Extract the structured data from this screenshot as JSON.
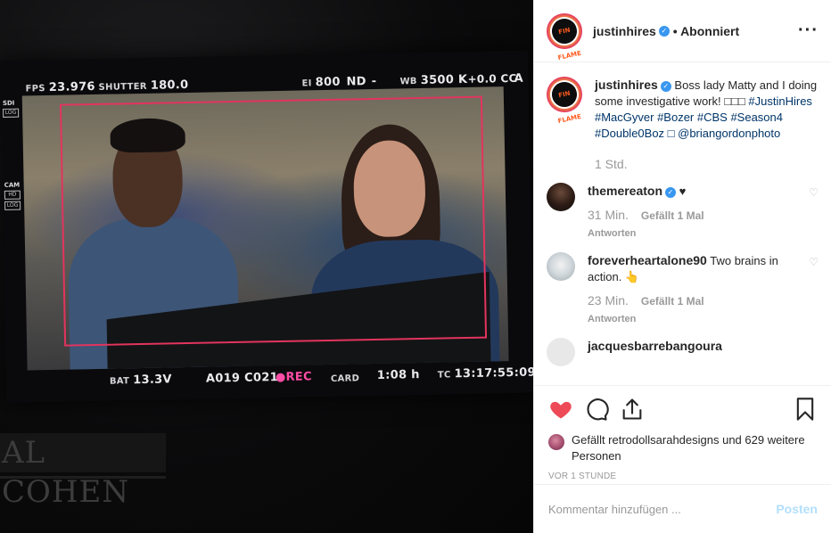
{
  "photo": {
    "hud_top": {
      "fps_label": "FPS",
      "fps_value": "23.976",
      "shutter_label": "SHUTTER",
      "shutter_value": "180.0",
      "ei_label": "EI",
      "ei_value": "800",
      "nd_label": "ND",
      "nd_value": "-",
      "wb_label": "WB",
      "wb_value": "3500 K",
      "cc_value": "+0.0 CC",
      "channel": "A"
    },
    "hud_bottom": {
      "bat_label": "BAT",
      "bat_value": "13.3V",
      "clip": "A019 C021",
      "rec": "●REC",
      "card_label": "CARD",
      "card_value": "1:08 h",
      "tc_label": "TC",
      "tc_value": "13:17:55:09"
    },
    "side_labels": {
      "sdi": "SDI",
      "log": "LOG",
      "cam": "CAM",
      "hd": "HD",
      "log2": "LOG"
    },
    "sign_text": "AL COHEN"
  },
  "post": {
    "author": "justinhires",
    "follow_status": "• Abonniert",
    "avatar_text": "FIN FLAME",
    "caption": {
      "text": "Boss lady Matty and I doing some investigative work! □□□",
      "tags": "#JustinHires #MacGyver #Bozer #CBS #Season4 #Double0Boz □ @briangordonphoto"
    },
    "caption_time": "1 Std.",
    "comments": [
      {
        "user": "themereaton",
        "verified": true,
        "text": "♥",
        "time": "31 Min.",
        "likes": "Gefällt 1 Mal",
        "reply": "Antworten"
      },
      {
        "user": "foreverheartalone90",
        "verified": false,
        "text": "Two brains in action. 👆",
        "time": "23 Min.",
        "likes": "Gefällt 1 Mal",
        "reply": "Antworten"
      },
      {
        "user": "jacquesbarrebangoura",
        "verified": false,
        "text": "",
        "time": "",
        "likes": "",
        "reply": ""
      }
    ],
    "likes_line": "Gefällt retrodollsarahdesigns und 629 weitere Personen",
    "post_time": "VOR 1 STUNDE",
    "comment_placeholder": "Kommentar hinzufügen ...",
    "post_button": "Posten",
    "more_icon": "more-horizontal-icon",
    "accent_like": "#ed4956",
    "link_color": "#003569"
  }
}
